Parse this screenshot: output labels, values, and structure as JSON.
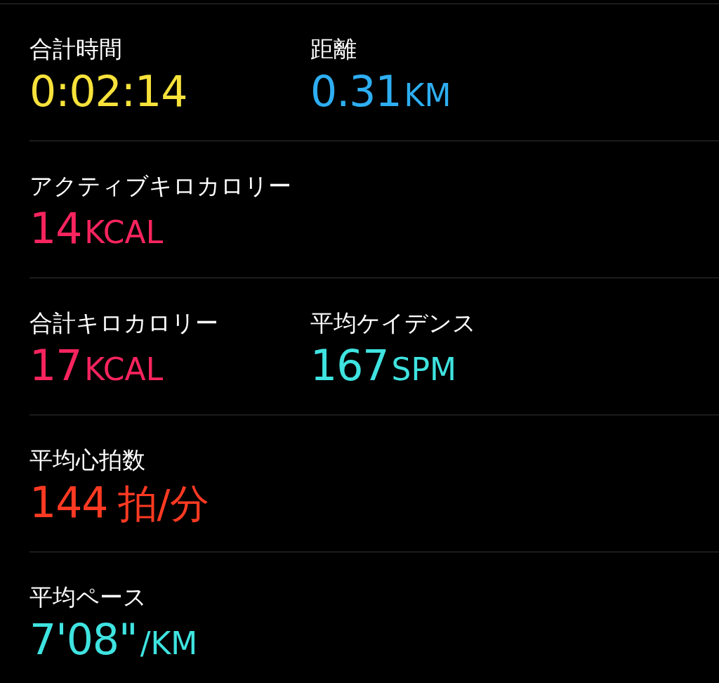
{
  "rows": [
    {
      "metrics": [
        {
          "label": "合計時間",
          "value": "0:02:14",
          "color": "#f7e23b"
        },
        {
          "label": "距離",
          "value": "0.31",
          "unit": "KM",
          "kind": "caps",
          "color": "#2eaef2"
        }
      ]
    },
    {
      "metrics": [
        {
          "label": "アクティブキロカロリー",
          "value": "14",
          "unit": "KCAL",
          "kind": "caps",
          "color": "#f7245e"
        }
      ]
    },
    {
      "metrics": [
        {
          "label": "合計キロカロリー",
          "value": "17",
          "unit": "KCAL",
          "kind": "caps",
          "color": "#f7245e"
        },
        {
          "label": "平均ケイデンス",
          "value": "167",
          "unit": "SPM",
          "kind": "caps",
          "color": "#3fe3e0"
        }
      ]
    },
    {
      "metrics": [
        {
          "label": "平均心拍数",
          "value": "144",
          "unit": "拍/分",
          "kind": "word",
          "color": "#ff3a22"
        }
      ]
    },
    {
      "metrics": [
        {
          "label": "平均ペース",
          "value": "7'08\"",
          "unit": "/KM",
          "kind": "caps",
          "color": "#3fe3e0"
        }
      ]
    }
  ]
}
